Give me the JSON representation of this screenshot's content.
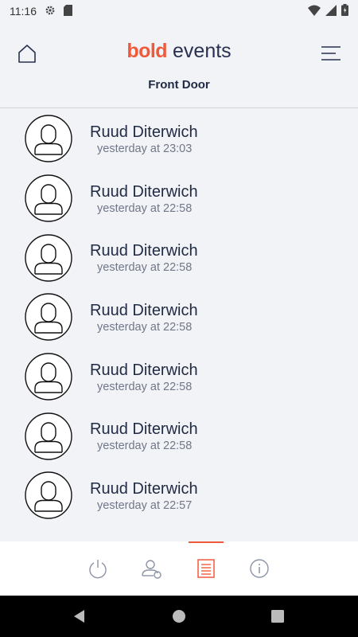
{
  "status_bar": {
    "time": "11:16",
    "icons": [
      "gear-icon",
      "sd-card-icon",
      "wifi-icon",
      "cell-signal-icon",
      "battery-icon"
    ]
  },
  "header": {
    "brand_bold": "bold",
    "brand_rest": " events",
    "subtitle": "Front Door",
    "icons": [
      "home-icon",
      "menu-icon"
    ]
  },
  "events": [
    {
      "name": "Ruud Diterwich",
      "time": "yesterday at 23:03"
    },
    {
      "name": "Ruud Diterwich",
      "time": "yesterday at 22:58"
    },
    {
      "name": "Ruud Diterwich",
      "time": "yesterday at 22:58"
    },
    {
      "name": "Ruud Diterwich",
      "time": "yesterday at 22:58"
    },
    {
      "name": "Ruud Diterwich",
      "time": "yesterday at 22:58"
    },
    {
      "name": "Ruud Diterwich",
      "time": "yesterday at 22:58"
    },
    {
      "name": "Ruud Diterwich",
      "time": "yesterday at 22:57"
    }
  ],
  "bottom_nav": {
    "items": [
      "power-icon",
      "users-icon",
      "events-list-icon",
      "info-icon"
    ],
    "active": "events-list-icon"
  },
  "colors": {
    "accent": "#ef5a3c",
    "text_dark": "#1f2a44",
    "text_muted": "#707789",
    "icon_inactive": "#8c93a5",
    "background": "#f2f3f6"
  }
}
